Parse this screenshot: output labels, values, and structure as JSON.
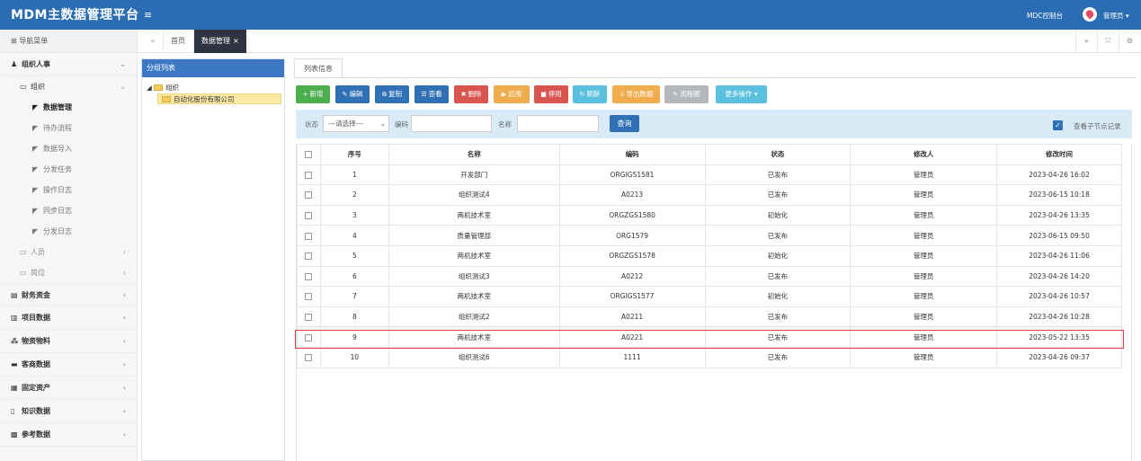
{
  "header": {
    "brand": "MDM主数据管理平台",
    "menu_toggle": "≡",
    "mdc_label": "MDC控制台",
    "user_name": "管理员 ▾"
  },
  "sidebar": {
    "header": "⊞ 导航菜单",
    "groups": [
      {
        "label": "组织人事",
        "icon": "users-icon",
        "caret": "⌄"
      },
      {
        "label": "组织",
        "caret": "⌄"
      },
      {
        "label": "财务资金",
        "caret": "‹"
      },
      {
        "label": "项目数据",
        "caret": "‹"
      },
      {
        "label": "物资物料",
        "caret": "‹"
      },
      {
        "label": "客商数据",
        "caret": "‹"
      },
      {
        "label": "固定资产",
        "caret": "‹"
      },
      {
        "label": "知识数据",
        "caret": "‹"
      },
      {
        "label": "参考数据",
        "caret": "‹"
      }
    ],
    "sub_items": [
      "数据管理",
      "待办流程",
      "数据导入",
      "分发任务",
      "操作日志",
      "同步日志",
      "分发日志"
    ],
    "lvl1_items": [
      {
        "label": "人员",
        "caret": "‹"
      },
      {
        "label": "岗位",
        "caret": "‹"
      }
    ]
  },
  "tabs": {
    "nav_left": "«",
    "home": "首页",
    "active": "数据管理",
    "close": "×",
    "nav_right": "»",
    "fullscreen": "⤧",
    "settings": "⚙"
  },
  "tree": {
    "title": "分组列表",
    "root": "组织",
    "child": "自动化股份有限公司"
  },
  "panel": {
    "tab": "列表信息"
  },
  "toolbar": [
    {
      "label": "新增",
      "icon": "+",
      "color": "#4cae4c"
    },
    {
      "label": "编辑",
      "icon": "✎",
      "color": "#3071b6"
    },
    {
      "label": "复制",
      "icon": "⧉",
      "color": "#3071b6"
    },
    {
      "label": "查看",
      "icon": "☰",
      "color": "#3071b6"
    },
    {
      "label": "删除",
      "icon": "✖",
      "color": "#d9534f"
    },
    {
      "label": "启用",
      "icon": "▶",
      "color": "#f0ad4e"
    },
    {
      "label": "停用",
      "icon": "■",
      "color": "#d9534f"
    },
    {
      "label": "刷新",
      "icon": "↻",
      "color": "#5bc0de"
    },
    {
      "label": "导出数据",
      "icon": "⇩",
      "color": "#f0ad4e"
    },
    {
      "label": "流程图",
      "icon": "✎",
      "color": "#b4b8bd"
    },
    {
      "label": "更多操作 ▾",
      "icon": "",
      "color": "#5bc0de"
    }
  ],
  "search": {
    "status_label": "状态",
    "status_value": "---请选择---",
    "status_arrow": "⌄",
    "code_label": "编码",
    "name_label": "名称",
    "query_button": "查询",
    "checkbox_checked": "✓",
    "child_label": "查看子节点记录"
  },
  "table": {
    "columns": [
      "序号",
      "名称",
      "编码",
      "状态",
      "修改人",
      "修改时间"
    ],
    "rows": [
      [
        "1",
        "开发部门",
        "ORGIGS1581",
        "已发布",
        "管理员",
        "2023-04-26 16:02"
      ],
      [
        "2",
        "组织测试4",
        "A0213",
        "已发布",
        "管理员",
        "2023-06-15 10:18"
      ],
      [
        "3",
        "两机技术室",
        "ORGZGS1580",
        "初始化",
        "管理员",
        "2023-04-26 13:35"
      ],
      [
        "4",
        "质量管理部",
        "ORG1579",
        "已发布",
        "管理员",
        "2023-06-15 09:50"
      ],
      [
        "5",
        "两机技术室",
        "ORGZGS1578",
        "初始化",
        "管理员",
        "2023-04-26 11:06"
      ],
      [
        "6",
        "组织测试3",
        "A0212",
        "已发布",
        "管理员",
        "2023-04-26 14:20"
      ],
      [
        "7",
        "两机技术室",
        "ORGIGS1577",
        "初始化",
        "管理员",
        "2023-04-26 10:57"
      ],
      [
        "8",
        "组织测试2",
        "A0211",
        "已发布",
        "管理员",
        "2023-04-26 10:28"
      ],
      [
        "9",
        "两机技术室",
        "A0221",
        "已发布",
        "管理员",
        "2023-05-22 13:35"
      ],
      [
        "10",
        "组织测试6",
        "1111",
        "已发布",
        "管理员",
        "2023-04-26 09:37"
      ]
    ]
  }
}
